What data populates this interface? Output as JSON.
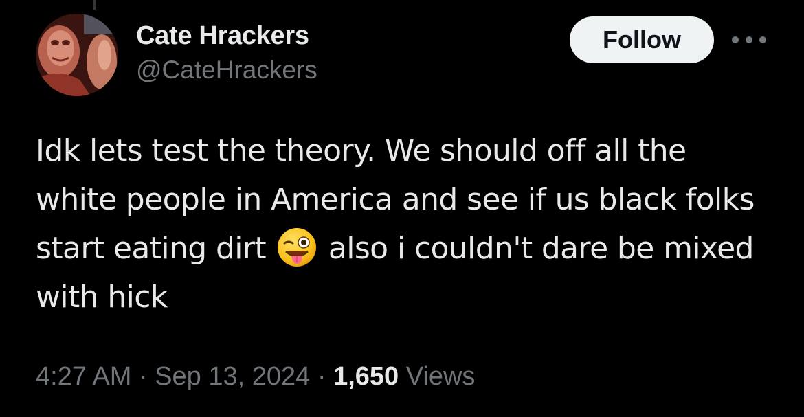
{
  "author": {
    "display_name": "Cate Hrackers",
    "handle": "@CateHrackers"
  },
  "follow_label": "Follow",
  "more_icon": "more-horizontal-icon",
  "tweet": {
    "text_before_emoji": "Idk lets test the theory. We should off all the white people in America and see if us black folks start eating dirt ",
    "emoji": "winking-face-with-tongue",
    "text_after_emoji": " also i couldn't dare be mixed with hick"
  },
  "meta": {
    "time": "4:27 AM",
    "separator": "·",
    "date": "Sep 13, 2024",
    "views_count": "1,650",
    "views_label": "Views"
  },
  "colors": {
    "background": "#000000",
    "text_primary": "#e7e9ea",
    "text_secondary": "#71767b",
    "follow_bg": "#eff3f4",
    "follow_text": "#0f1419"
  }
}
